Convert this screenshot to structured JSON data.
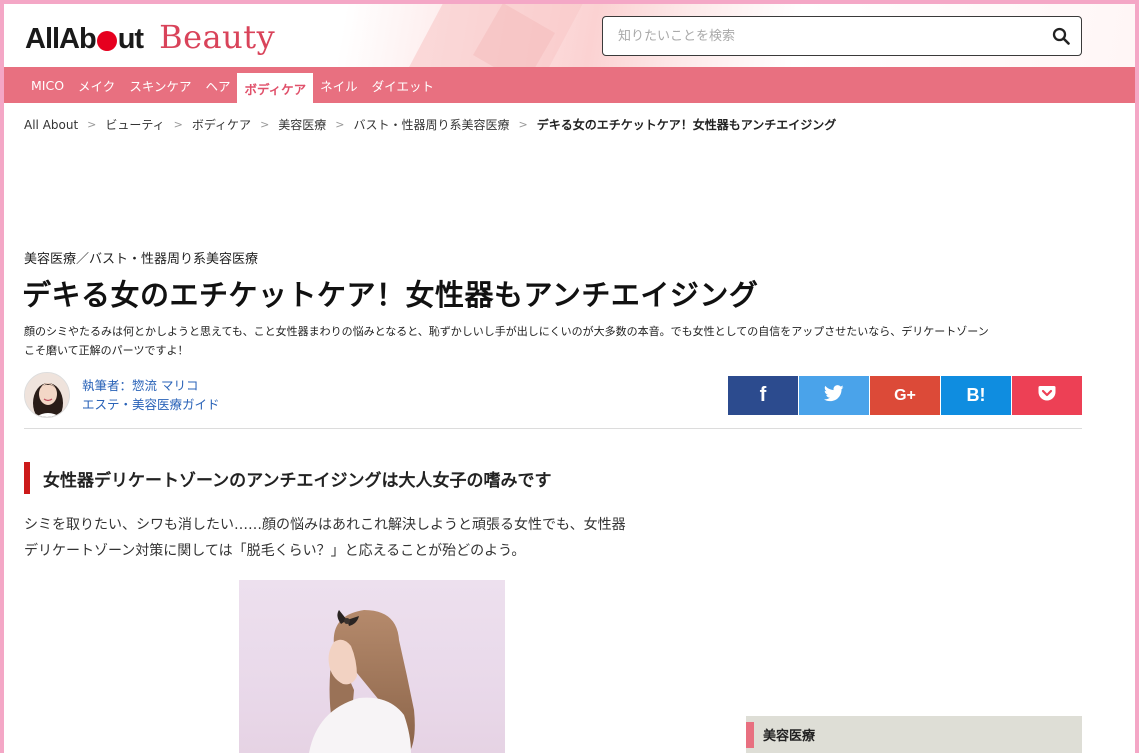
{
  "header": {
    "logo_allabout_pre": "AllAb",
    "logo_allabout_post": "ut",
    "logo_beauty": "Beauty",
    "search_placeholder": "知りたいことを検索"
  },
  "nav": {
    "items": [
      {
        "label": "MICO"
      },
      {
        "label": "メイク"
      },
      {
        "label": "スキンケア"
      },
      {
        "label": "ヘア"
      },
      {
        "label": "ボディケア",
        "active": true
      },
      {
        "label": "ネイル"
      },
      {
        "label": "ダイエット"
      }
    ]
  },
  "breadcrumb": {
    "items": [
      "All About",
      "ビューティ",
      "ボディケア",
      "美容医療",
      "バスト・性器周り系美容医療"
    ],
    "current": "デキる女のエチケットケア！女性器もアンチエイジング",
    "separator": ">"
  },
  "article": {
    "category": "美容医療／バスト・性器周り系美容医療",
    "title": "デキる女のエチケットケア！女性器もアンチエイジング",
    "lead_line1": "顔のシミやたるみは何とかしようと思えても、こと女性器まわりの悩みとなると、恥ずかしいし手が出しにくいのが大多数の本音。でも女性としての自信をアップさせたいなら、デリケートゾーン",
    "lead_line2": "こそ磨いて正解のパーツですよ！",
    "author_name": "執筆者：惣流 マリコ",
    "author_role": "エステ・美容医療ガイド"
  },
  "share": {
    "buttons": [
      {
        "icon": "facebook-icon",
        "label": "f",
        "color": "#2c4b8e"
      },
      {
        "icon": "twitter-icon",
        "label": "",
        "color": "#4aa3ea"
      },
      {
        "icon": "google-plus-icon",
        "label": "G+",
        "color": "#dc4a38"
      },
      {
        "icon": "hatena-bookmark-icon",
        "label": "B!",
        "color": "#0f8de0"
      },
      {
        "icon": "pocket-icon",
        "label": "",
        "color": "#ed4055"
      }
    ]
  },
  "section": {
    "heading": "女性器デリケートゾーンのアンチエイジングは大人女子の嗜みです",
    "paragraph_line1": "シミを取りたい、シワも消したい……顔の悩みはあれこれ解決しようと頑張る女性でも、女性器",
    "paragraph_line2": "デリケートゾーン対策に関しては「脱毛くらい？」と応えることが殆どのよう。"
  },
  "sidebar": {
    "box_title": "美容医療"
  },
  "colors": {
    "nav_bg": "#e87080",
    "frame": "#f4a7c6",
    "accent_red": "#e6001f",
    "section_bar": "#cc1a1a",
    "link_blue": "#2a63b8"
  }
}
